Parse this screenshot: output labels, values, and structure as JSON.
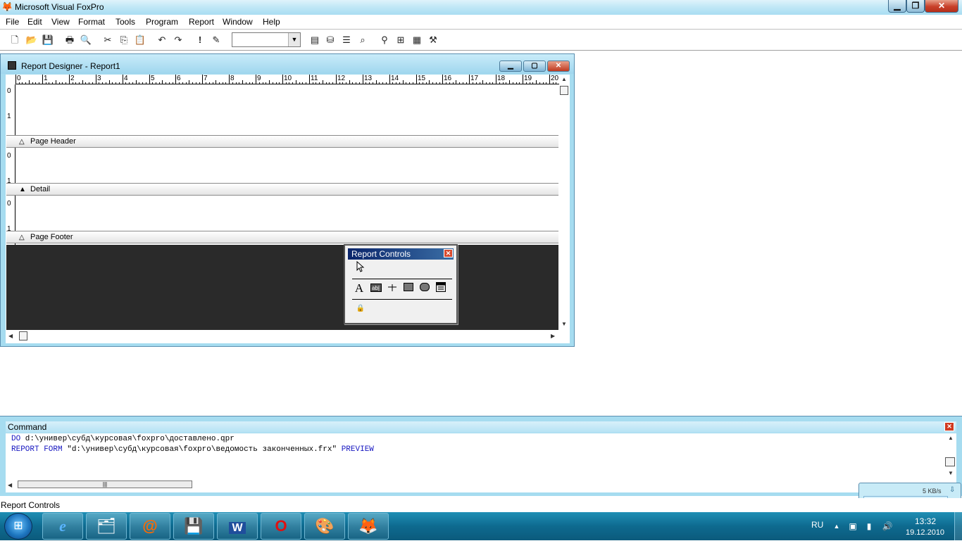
{
  "window": {
    "title": "Microsoft Visual FoxPro",
    "minimize_label": "▁",
    "maximize_label": "❐",
    "close_label": "✕"
  },
  "menu": {
    "items": [
      "File",
      "Edit",
      "View",
      "Format",
      "Tools",
      "Program",
      "Report",
      "Window",
      "Help"
    ]
  },
  "toolbar": {
    "buttons": [
      "new-icon",
      "open-icon",
      "save-icon",
      "print-icon",
      "print-preview-icon",
      "cut-icon",
      "copy-icon",
      "paste-icon",
      "undo-icon",
      "redo-icon",
      "run-icon",
      "modify-icon",
      "command-window-icon",
      "data-session-icon",
      "properties-icon",
      "code-icon",
      "class-browser-icon",
      "object-browser-icon",
      "component-gallery-icon",
      "toolbox-icon"
    ],
    "combo_value": ""
  },
  "report_designer": {
    "title": "Report Designer - Report1",
    "ruler_numbers": [
      "0",
      "1",
      "2",
      "3",
      "4",
      "5",
      "6",
      "7",
      "8",
      "9",
      "10",
      "11",
      "12",
      "13",
      "14",
      "15",
      "16",
      "17",
      "18",
      "19",
      "20"
    ],
    "vruler_numbers": [
      "0",
      "1",
      "0",
      "1",
      "0",
      "1"
    ],
    "bands": [
      {
        "label": "Page Header"
      },
      {
        "label": "Detail"
      },
      {
        "label": "Page Footer"
      }
    ]
  },
  "report_controls": {
    "title": "Report Controls",
    "tools": [
      "select-objects-icon",
      "label-tool-icon",
      "field-tool-icon",
      "line-tool-icon",
      "rectangle-tool-icon",
      "rounded-rectangle-tool-icon",
      "picture-ole-tool-icon",
      "button-lock-icon"
    ]
  },
  "command_window": {
    "title": "Command",
    "lines": [
      {
        "keyword": "DO",
        "text": " d:\\универ\\субд\\курсовая\\foxpro\\доставлено.qpr",
        "suffix": ""
      },
      {
        "keyword": "REPORT FORM",
        "text": " \"d:\\универ\\субд\\курсовая\\foxpro\\ведомость законченных.frx\" ",
        "suffix": "PREVIEW"
      }
    ]
  },
  "network_widget": {
    "speed": "5 KB/s"
  },
  "status_bar": {
    "text": "Report Controls"
  },
  "taskbar": {
    "items": [
      "internet-explorer-icon",
      "file-explorer-icon",
      "mail-icon",
      "floppy-save-icon",
      "word-icon",
      "opera-icon",
      "paint-icon",
      "foxpro-icon"
    ],
    "language": "RU",
    "time": "13:32",
    "date": "19.12.2010"
  },
  "colors": {
    "title_bar": "#bfe7f6",
    "keyword_blue": "#1515c0",
    "designer_dark_area": "#2a2a2a",
    "taskbar": "#0e6a8f"
  }
}
